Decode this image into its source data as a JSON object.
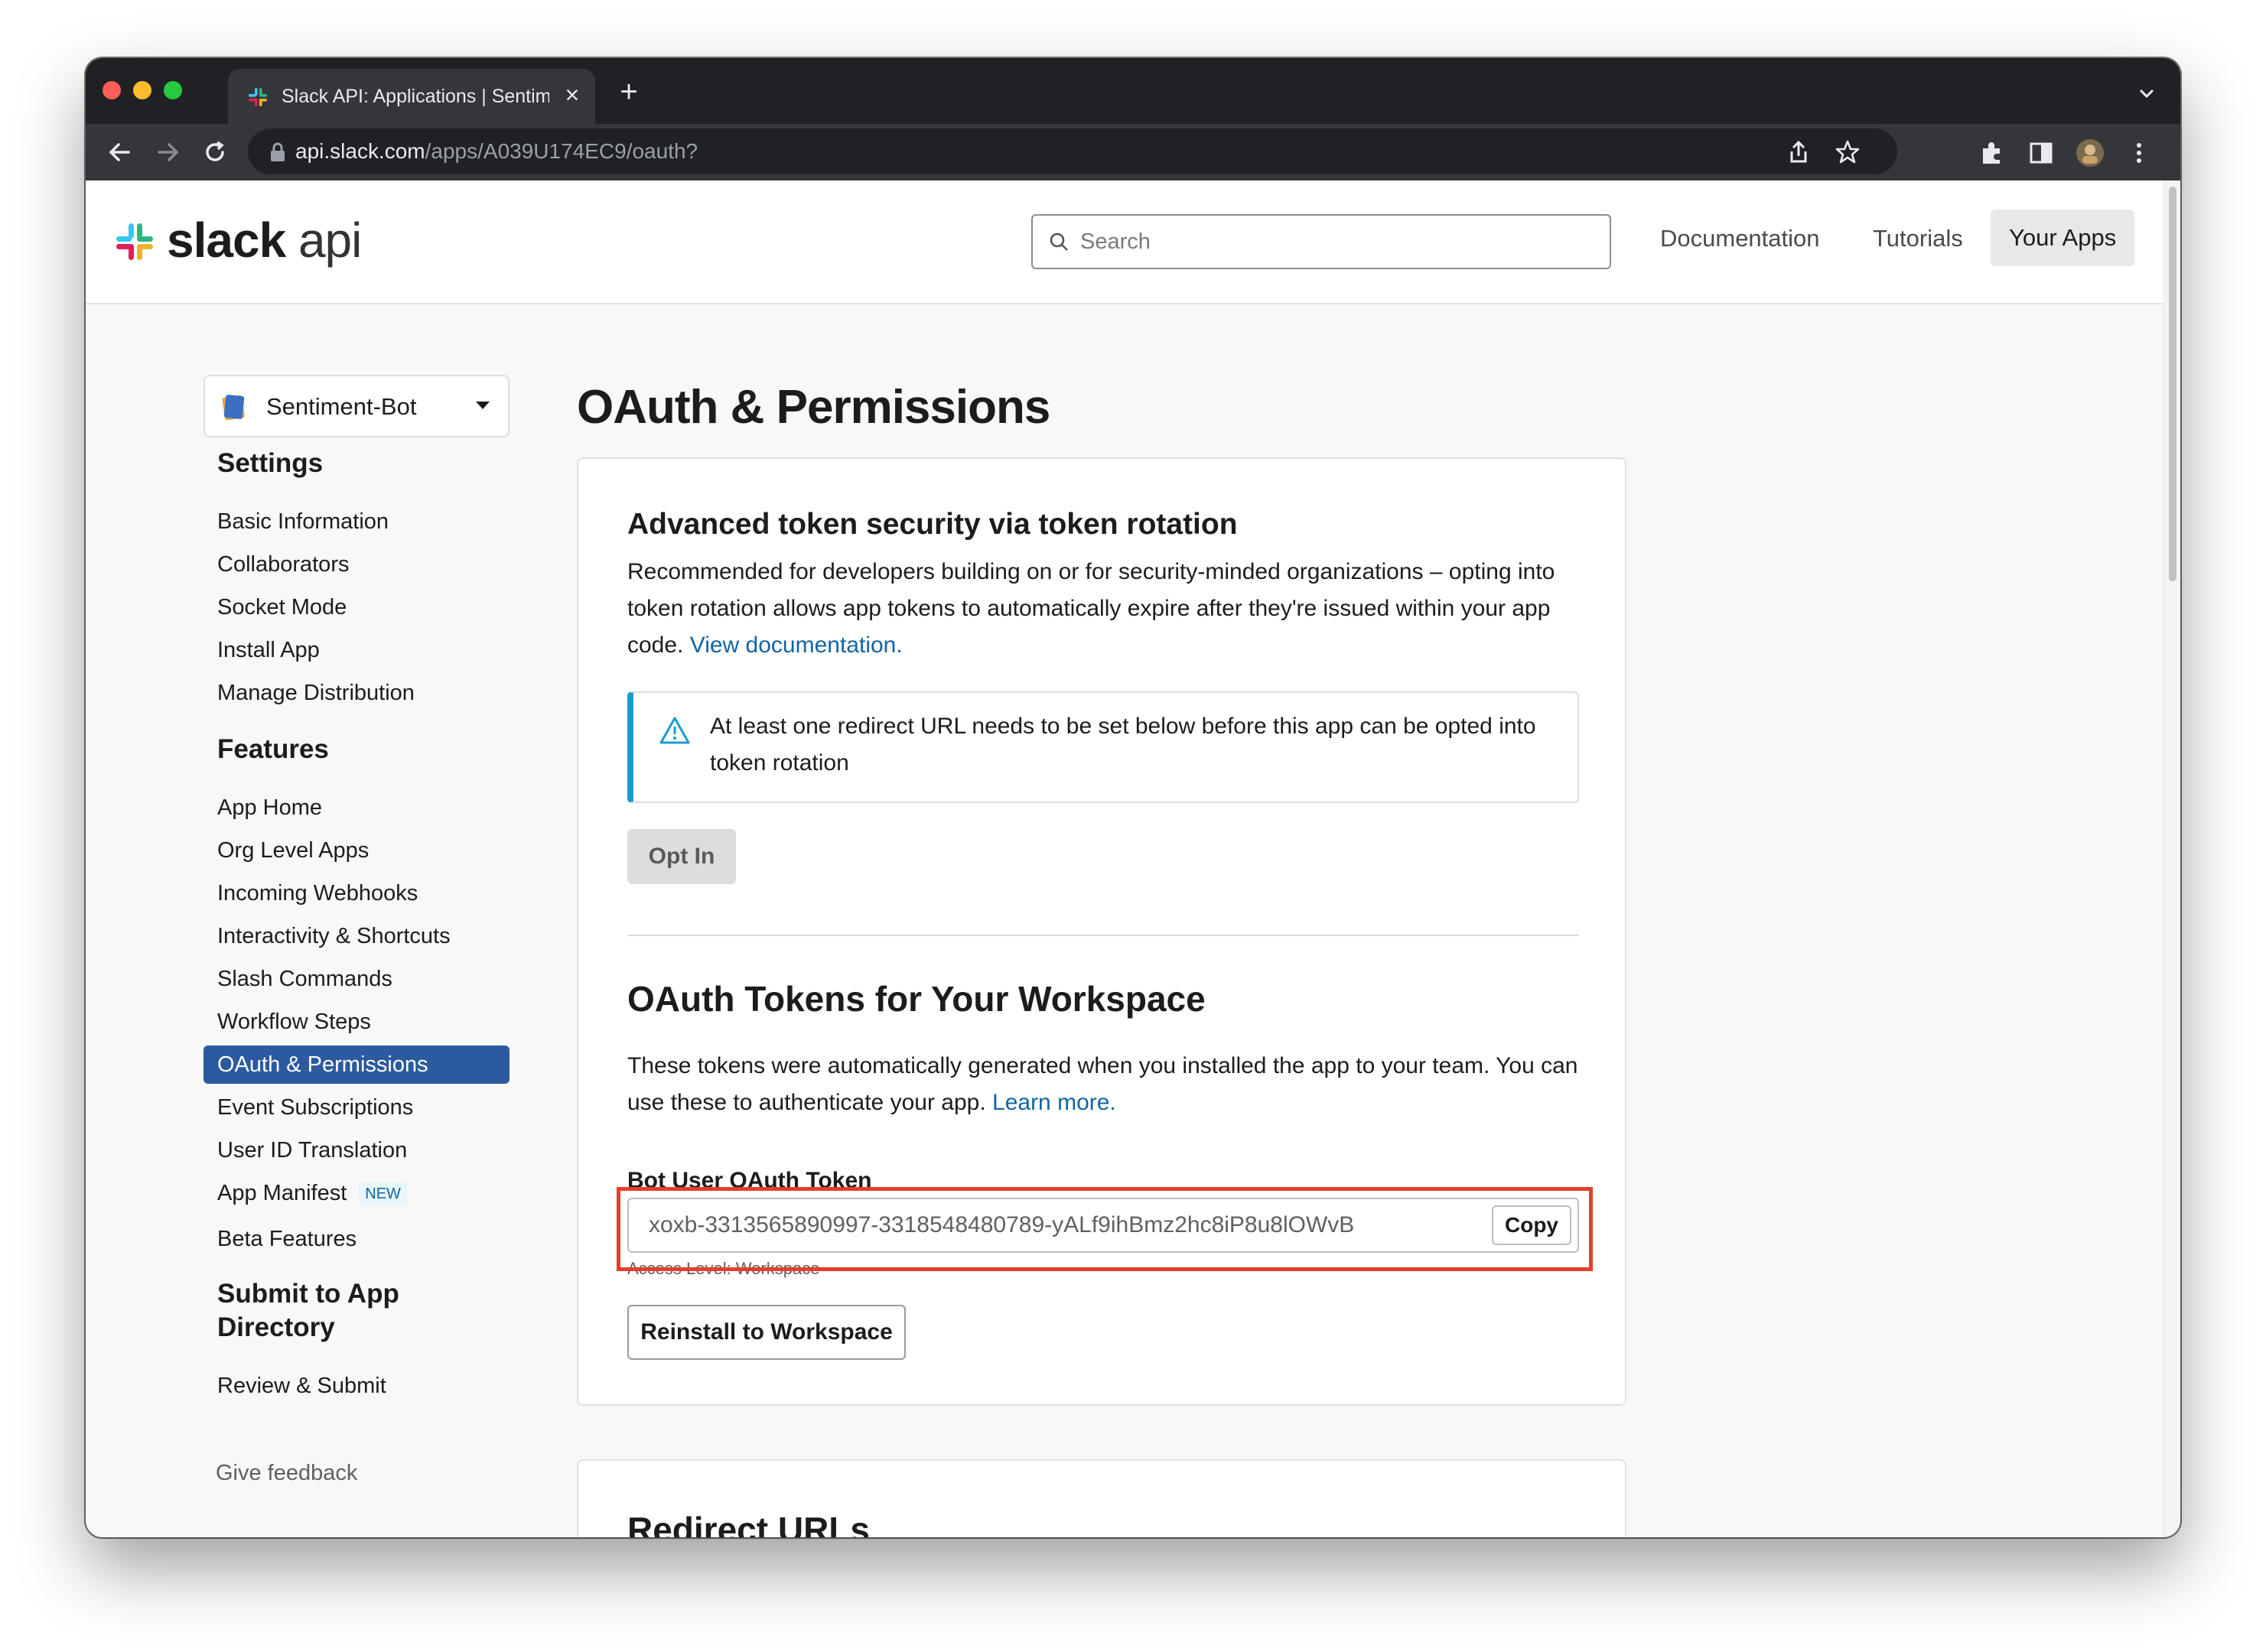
{
  "browser": {
    "tab_title": "Slack API: Applications | Sentiment-Bot",
    "url_host": "api.slack.com",
    "url_path": "/apps/A039U174EC9/oauth?"
  },
  "header": {
    "logo_bold": "slack",
    "logo_light": "api",
    "search_placeholder": "Search",
    "nav": [
      "Documentation",
      "Tutorials",
      "Your Apps"
    ]
  },
  "sidebar": {
    "app_name": "Sentiment-Bot",
    "settings_heading": "Settings",
    "settings_items": [
      "Basic Information",
      "Collaborators",
      "Socket Mode",
      "Install App",
      "Manage Distribution"
    ],
    "features_heading": "Features",
    "features_items": [
      "App Home",
      "Org Level Apps",
      "Incoming Webhooks",
      "Interactivity & Shortcuts",
      "Slash Commands",
      "Workflow Steps",
      "OAuth & Permissions",
      "Event Subscriptions",
      "User ID Translation",
      "App Manifest",
      "Beta Features"
    ],
    "new_badge": "NEW",
    "submit_heading_line1": "Submit to App",
    "submit_heading_line2": "Directory",
    "submit_items": [
      "Review & Submit"
    ],
    "feedback": "Give feedback"
  },
  "main": {
    "page_title": "OAuth & Permissions",
    "rotation": {
      "heading": "Advanced token security via token rotation",
      "description": "Recommended for developers building on or for security-minded organizations – opting into token rotation allows app tokens to automatically expire after they're issued within your app code.",
      "link": "View documentation.",
      "warning": "At least one redirect URL needs to be set below before this app can be opted into token rotation",
      "opt_in": "Opt In"
    },
    "tokens": {
      "heading": "OAuth Tokens for Your Workspace",
      "description": "These tokens were automatically generated when you installed the app to your team. You can use these to authenticate your app.",
      "link": "Learn more.",
      "label": "Bot User OAuth Token",
      "token": "xoxb-3313565890997-3318548480789-yALf9ihBmz2hc8iP8u8lOWvB",
      "copy": "Copy",
      "access_level": "Access Level: Workspace",
      "reinstall": "Reinstall to Workspace"
    },
    "redirect_heading": "Redirect URLs"
  },
  "colors": {
    "active_nav": "#2c5a9e",
    "link": "#1264a3",
    "highlight": "#e0402d",
    "info_border": "#1d9bd1"
  }
}
